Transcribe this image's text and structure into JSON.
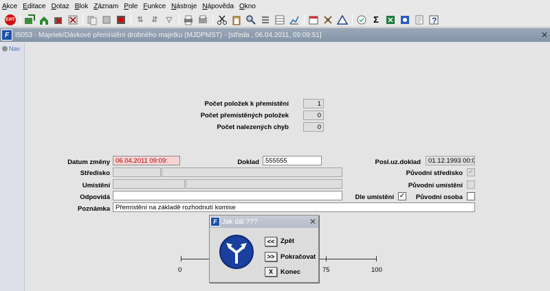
{
  "menu": [
    {
      "ul": "A",
      "rest": "kce"
    },
    {
      "ul": "E",
      "rest": "ditace"
    },
    {
      "ul": "D",
      "rest": "otaz"
    },
    {
      "ul": "B",
      "rest": "lok"
    },
    {
      "ul": "Z",
      "rest": "áznam"
    },
    {
      "ul": "P",
      "rest": "ole"
    },
    {
      "ul": "F",
      "rest": "unkce"
    },
    {
      "ul": "N",
      "rest": "ástroje"
    },
    {
      "ul": "N",
      "rest": "ápověda"
    },
    {
      "ul": "O",
      "rest": "kno"
    }
  ],
  "toolbar": {
    "exit_label": "EXIT"
  },
  "window": {
    "app_icon": "F",
    "title": "I5053 - Majetek/Dávkové přemístění drobného majetku (MJDPMST) - [středa , 06.04.2011, 09:09:51]",
    "close": "✕"
  },
  "nav": {
    "label": "Nav"
  },
  "summary": {
    "items_to_move_label": "Počet položek k přemístění",
    "items_to_move": "1",
    "moved_items_label": "Počet přemístěných položek",
    "moved_items": "0",
    "errors_label": "Počet nalezených chyb",
    "errors": "0"
  },
  "form": {
    "change_date_label": "Datum změny",
    "change_date": "06.04.2011 09:09:",
    "doklad_label": "Doklad",
    "doklad": "555555",
    "last_doc_label": "Posl.uz.doklad",
    "last_doc": "01.12.1993 00:00:",
    "center_label": "Středisko",
    "center_code": "",
    "center_name": "",
    "orig_center_label": "Původní středisko",
    "orig_center_checked": "✓",
    "location_label": "Umístění",
    "location_code": "",
    "location_sub": "",
    "location_name": "",
    "orig_location_label": "Původní umístění",
    "responsible_label": "Odpovídá",
    "responsible": "",
    "by_location_label": "Dle umístění",
    "by_location_checked": "✓",
    "orig_person_label": "Původní osoba",
    "note_label": "Poznámka",
    "note": "Přemístění na základě rozhodnutí komise"
  },
  "scale": {
    "labels": [
      "0",
      "75",
      "100"
    ]
  },
  "dialog": {
    "app_icon": "F",
    "title": "Jak dál ???",
    "close": "✕",
    "back_btn": "<<",
    "back_label": "Zpět",
    "continue_btn": ">>",
    "continue_label": "Pokračovat",
    "end_btn": "X",
    "end_label": "Konec"
  }
}
